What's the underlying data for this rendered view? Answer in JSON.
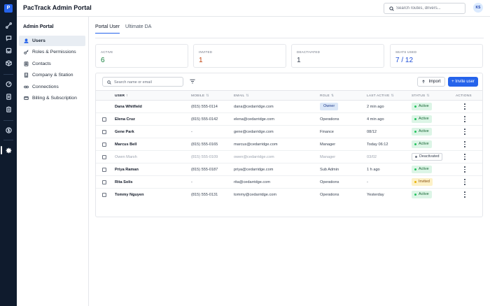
{
  "app": {
    "logo_letter": "P",
    "title": "PacTrack Admin Portal"
  },
  "header": {
    "search_placeholder": "Search routes, drivers...",
    "avatar_initials": "KS"
  },
  "rail": {
    "icons": [
      "route-icon",
      "chat-icon",
      "inbox-icon",
      "package-icon",
      "gauge-icon",
      "document-icon",
      "clipboard-icon",
      "dollar-icon",
      "gear-icon"
    ]
  },
  "sidebar": {
    "title": "Admin Portal",
    "items": [
      {
        "label": "Users",
        "icon": "user-icon",
        "active": true
      },
      {
        "label": "Roles & Permissions",
        "icon": "key-icon",
        "active": false
      },
      {
        "label": "Contacts",
        "icon": "contacts-icon",
        "active": false
      },
      {
        "label": "Company & Station",
        "icon": "building-icon",
        "active": false
      },
      {
        "label": "Connections",
        "icon": "link-icon",
        "active": false
      },
      {
        "label": "Billing & Subscription",
        "icon": "credit-card-icon",
        "active": false
      }
    ]
  },
  "tabs": [
    {
      "label": "Portal User",
      "active": true
    },
    {
      "label": "Ultimate DA",
      "active": false
    }
  ],
  "stats": [
    {
      "label": "ACTIVE",
      "value": "6",
      "color": "#15803d"
    },
    {
      "label": "INVITED",
      "value": "1",
      "color": "#c2410c"
    },
    {
      "label": "DEACTIVATED",
      "value": "1",
      "color": "#374151"
    },
    {
      "label": "SEATS USED",
      "value": "7 / 12",
      "color": "#1d4ed8"
    }
  ],
  "table": {
    "search_placeholder": "Search name or email",
    "import_label": "Import",
    "invite_label": "+ Invite user",
    "columns": {
      "user": "USER",
      "mobile": "MOBILE",
      "email": "EMAIL",
      "role": "ROLE",
      "last_active": "LAST ACTIVE",
      "status": "STATUS",
      "actions": "ACTIONS"
    },
    "sort_up": "↑",
    "sort_both": "⇅",
    "rows": [
      {
        "name": "Dana Whitfield",
        "mobile": "(815) 555-0114",
        "email": "dana@cedarridge.com",
        "role": "Owner",
        "last_active": "2 min ago",
        "status": "Active"
      },
      {
        "name": "Elena Cruz",
        "mobile": "(815) 555-0142",
        "email": "elena@cedarridge.com",
        "role": "Operations",
        "last_active": "4 min ago",
        "status": "Active"
      },
      {
        "name": "Gene Park",
        "mobile": "-",
        "email": "gene@cedarridge.com",
        "role": "Finance",
        "last_active": "08/12",
        "status": "Active"
      },
      {
        "name": "Marcus Bell",
        "mobile": "(815) 555-0165",
        "email": "marcus@cedarridge.com",
        "role": "Manager",
        "last_active": "Today 06:12",
        "status": "Active"
      },
      {
        "name": "Owen Marsh",
        "mobile": "(815) 555-0109",
        "email": "owen@cedarridge.com",
        "role": "Manager",
        "last_active": "03/02",
        "status": "Deactivated"
      },
      {
        "name": "Priya Raman",
        "mobile": "(815) 555-0187",
        "email": "priya@cedarridge.com",
        "role": "Sub Admin",
        "last_active": "1 h ago",
        "status": "Active"
      },
      {
        "name": "Rita Solis",
        "mobile": "-",
        "email": "rita@cedarridge.com",
        "role": "Operations",
        "last_active": "-",
        "status": "Invited"
      },
      {
        "name": "Tommy Nguyen",
        "mobile": "(815) 555-0131",
        "email": "tommy@cedarridge.com",
        "role": "Operations",
        "last_active": "Yesterday",
        "status": "Active"
      }
    ]
  }
}
